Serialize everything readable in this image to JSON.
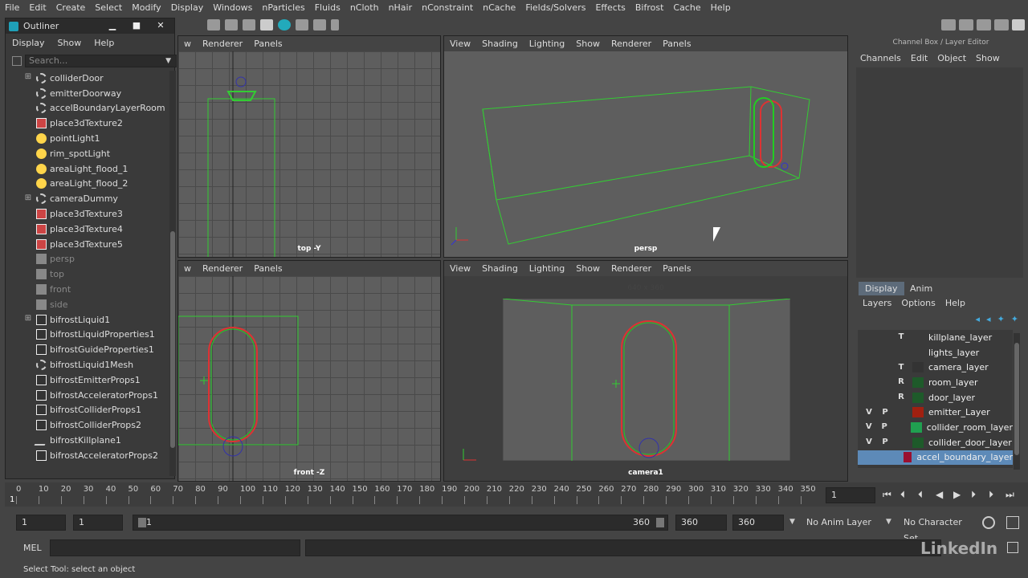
{
  "menubar": {
    "items": [
      "File",
      "Edit",
      "Create",
      "Select",
      "Modify",
      "Display",
      "Windows",
      "nParticles",
      "Fluids",
      "nCloth",
      "nHair",
      "nConstraint",
      "nCache",
      "Fields/Solvers",
      "Effects",
      "Bifrost",
      "Cache",
      "Help"
    ]
  },
  "outliner": {
    "title": "Outliner",
    "menu": [
      "Display",
      "Show",
      "Help"
    ],
    "search_placeholder": "Search...",
    "items": [
      {
        "label": "colliderDoor",
        "icon": "transform-icon",
        "expand": true,
        "dim": false
      },
      {
        "label": "emitterDoorway",
        "icon": "transform-icon",
        "expand": false,
        "dim": false
      },
      {
        "label": "accelBoundaryLayerRoom",
        "icon": "transform-icon",
        "expand": false,
        "dim": false
      },
      {
        "label": "place3dTexture2",
        "icon": "texture-icon",
        "expand": false,
        "dim": false
      },
      {
        "label": "pointLight1",
        "icon": "light-icon",
        "expand": false,
        "dim": false
      },
      {
        "label": "rim_spotLight",
        "icon": "light-icon",
        "expand": false,
        "dim": false
      },
      {
        "label": "areaLight_flood_1",
        "icon": "light-icon",
        "expand": false,
        "dim": false
      },
      {
        "label": "areaLight_flood_2",
        "icon": "light-icon",
        "expand": false,
        "dim": false
      },
      {
        "label": "cameraDummy",
        "icon": "transform-icon",
        "expand": true,
        "dim": false
      },
      {
        "label": "place3dTexture3",
        "icon": "texture-icon",
        "expand": false,
        "dim": false
      },
      {
        "label": "place3dTexture4",
        "icon": "texture-icon",
        "expand": false,
        "dim": false
      },
      {
        "label": "place3dTexture5",
        "icon": "texture-icon",
        "expand": false,
        "dim": false
      },
      {
        "label": "persp",
        "icon": "camera-icon",
        "expand": false,
        "dim": true
      },
      {
        "label": "top",
        "icon": "camera-icon",
        "expand": false,
        "dim": true
      },
      {
        "label": "front",
        "icon": "camera-icon",
        "expand": false,
        "dim": true
      },
      {
        "label": "side",
        "icon": "camera-icon",
        "expand": false,
        "dim": true
      },
      {
        "label": "bifrostLiquid1",
        "icon": "node-icon",
        "expand": true,
        "dim": false
      },
      {
        "label": "bifrostLiquidProperties1",
        "icon": "node-icon",
        "expand": false,
        "dim": false
      },
      {
        "label": "bifrostGuideProperties1",
        "icon": "node-icon",
        "expand": false,
        "dim": false
      },
      {
        "label": "bifrostLiquid1Mesh",
        "icon": "transform-icon",
        "expand": false,
        "dim": false
      },
      {
        "label": "bifrostEmitterProps1",
        "icon": "node-icon",
        "expand": false,
        "dim": false
      },
      {
        "label": "bifrostAcceleratorProps1",
        "icon": "node-icon",
        "expand": false,
        "dim": false
      },
      {
        "label": "bifrostColliderProps1",
        "icon": "node-icon",
        "expand": false,
        "dim": false
      },
      {
        "label": "bifrostColliderProps2",
        "icon": "node-icon",
        "expand": false,
        "dim": false
      },
      {
        "label": "bifrostKillplane1",
        "icon": "killplane-icon",
        "expand": false,
        "dim": false
      },
      {
        "label": "bifrostAcceleratorProps2",
        "icon": "node-icon",
        "expand": false,
        "dim": false
      }
    ]
  },
  "viewports": {
    "top": {
      "menu": [
        "w",
        "Renderer",
        "Panels"
      ],
      "label": "top -Y"
    },
    "persp": {
      "menu": [
        "View",
        "Shading",
        "Lighting",
        "Show",
        "Renderer",
        "Panels"
      ],
      "label": "persp"
    },
    "front": {
      "menu": [
        "w",
        "Renderer",
        "Panels"
      ],
      "label": "front -Z"
    },
    "camera1": {
      "menu": [
        "View",
        "Shading",
        "Lighting",
        "Show",
        "Renderer",
        "Panels"
      ],
      "label": "camera1",
      "res": "640 x 360"
    }
  },
  "channelbox": {
    "title": "Channel Box / Layer Editor",
    "menu": [
      "Channels",
      "Edit",
      "Object",
      "Show"
    ]
  },
  "layereditor": {
    "tabs": [
      "Display",
      "Anim"
    ],
    "menu": [
      "Layers",
      "Options",
      "Help"
    ],
    "layers": [
      {
        "v": "",
        "p": "",
        "t": "T",
        "color": "#3a3a3a",
        "name": "killplane_layer",
        "sel": false
      },
      {
        "v": "",
        "p": "",
        "t": "",
        "color": "#3a3a3a",
        "name": "lights_layer",
        "sel": false
      },
      {
        "v": "",
        "p": "",
        "t": "T",
        "color": "#333333",
        "name": "camera_layer",
        "sel": false
      },
      {
        "v": "",
        "p": "",
        "t": "R",
        "color": "#1e5a2a",
        "name": "room_layer",
        "sel": false
      },
      {
        "v": "",
        "p": "",
        "t": "R",
        "color": "#1e5a2a",
        "name": "door_layer",
        "sel": false
      },
      {
        "v": "V",
        "p": "P",
        "t": "",
        "color": "#a02010",
        "name": "emitter_Layer",
        "sel": false
      },
      {
        "v": "V",
        "p": "P",
        "t": "",
        "color": "#20a050",
        "name": "collider_room_layer",
        "sel": false
      },
      {
        "v": "V",
        "p": "P",
        "t": "",
        "color": "#1e5a2a",
        "name": "collider_door_layer",
        "sel": false
      },
      {
        "v": "",
        "p": "",
        "t": "",
        "color": "#9a1030",
        "name": "accel_boundary_layer",
        "sel": true
      }
    ]
  },
  "timeline": {
    "ticks": [
      "0",
      "10",
      "20",
      "30",
      "40",
      "50",
      "60",
      "70",
      "80",
      "90",
      "100",
      "110",
      "120",
      "130",
      "140",
      "150",
      "160",
      "170",
      "180",
      "190",
      "200",
      "210",
      "220",
      "230",
      "240",
      "250",
      "260",
      "270",
      "280",
      "290",
      "300",
      "310",
      "320",
      "330",
      "340",
      "350"
    ],
    "current": "1",
    "frame_field": "1"
  },
  "range": {
    "start": "1",
    "start2": "1",
    "slider_start": "1",
    "slider_end": "360",
    "end": "360",
    "end2": "360",
    "anim_layer": "No Anim Layer",
    "char_set": "No Character Set"
  },
  "cmd": {
    "label": "MEL"
  },
  "status": {
    "text": "Select Tool: select an object"
  },
  "watermark": "LinkedIn"
}
